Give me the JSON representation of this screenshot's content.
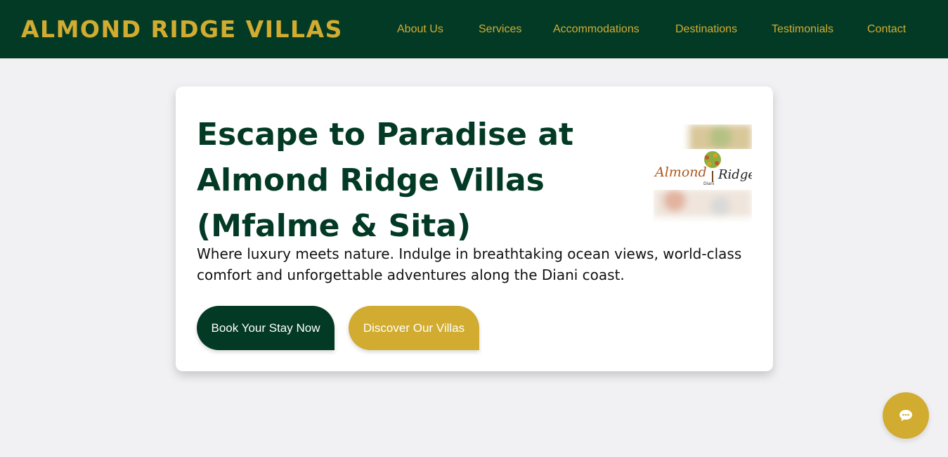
{
  "header": {
    "brand": "ALMOND RIDGE VILLAS",
    "nav": [
      {
        "label": "About Us"
      },
      {
        "label": "Services"
      },
      {
        "label": "Accommodations"
      },
      {
        "label": "Destinations"
      },
      {
        "label": "Testimonials"
      },
      {
        "label": "Contact"
      }
    ]
  },
  "hero": {
    "title": "Escape to Paradise at Almond Ridge Villas (Mfalme & Sita)",
    "subtitle": "Where luxury meets nature. Indulge in breathtaking ocean views, world-class comfort and unforgettable adventures along the Diani coast.",
    "primary_button": "Book Your Stay Now",
    "secondary_button": "Discover Our Villas",
    "logo": {
      "word1": "Almond",
      "word2": "Ridge",
      "small": "Diani"
    }
  },
  "chat": {
    "icon": "chat-bubble-icon"
  },
  "colors": {
    "nav_bg": "#033a26",
    "accent_gold": "#d1ac30",
    "page_bg": "#f1f1f3"
  }
}
